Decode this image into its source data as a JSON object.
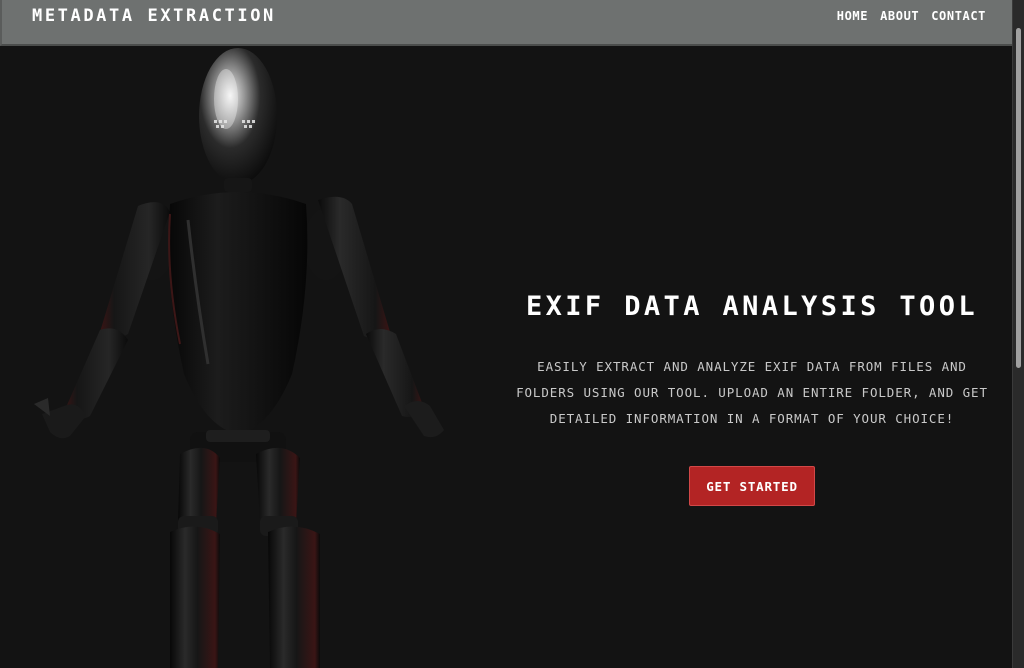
{
  "header": {
    "brand": "METADATA EXTRACTION",
    "nav": [
      "HOME",
      "ABOUT",
      "CONTACT"
    ]
  },
  "hero": {
    "title": "EXIF DATA ANALYSIS TOOL",
    "description": "EASILY EXTRACT AND ANALYZE EXIF DATA FROM FILES AND FOLDERS USING OUR TOOL. UPLOAD AN ENTIRE FOLDER, AND GET DETAILED INFORMATION IN A FORMAT OF YOUR CHOICE!",
    "cta_label": "GET STARTED"
  },
  "colors": {
    "background": "#131313",
    "navbar": "#6e7170",
    "accent": "#b32424",
    "text": "#ffffff",
    "muted_text": "#c9c9c9"
  },
  "icons": {
    "hero_image": "robot-illustration"
  }
}
